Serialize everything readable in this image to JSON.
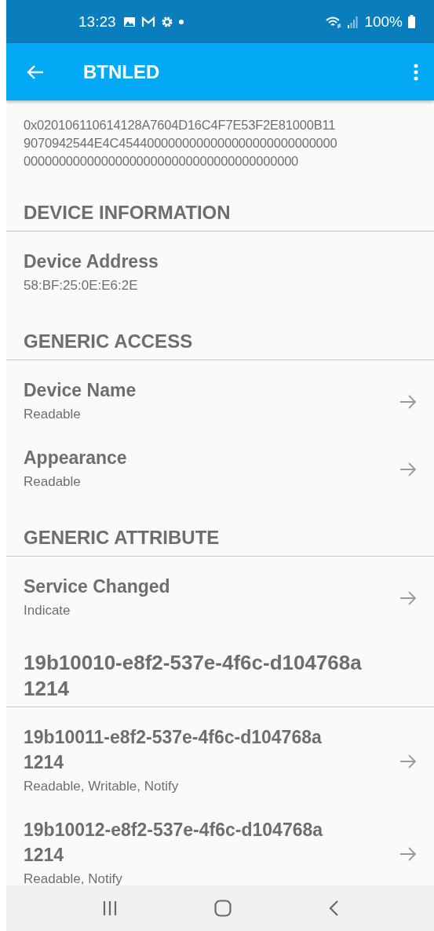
{
  "status_bar": {
    "time": "13:23",
    "battery": "100%"
  },
  "app_bar": {
    "title": "BTNLED"
  },
  "raw_packet": {
    "value": "0x020106110614128A7604D16C4F7E53F2E81000B11\n9070942544E4C4544000000000000000000000000000\n000000000000000000000000000000000000000"
  },
  "rows": [
    {
      "kind": "heading",
      "title": "DEVICE INFORMATION"
    },
    {
      "kind": "entry",
      "title": "Device Address",
      "detail": "58:BF:25:0E:E6:2E"
    },
    {
      "kind": "heading",
      "title": "GENERIC ACCESS"
    },
    {
      "kind": "entry",
      "title": "Device Name",
      "detail": "Readable",
      "navigable": true
    },
    {
      "kind": "entry",
      "title": "Appearance",
      "detail": "Readable",
      "navigable": true
    },
    {
      "kind": "heading",
      "title": "GENERIC ATTRIBUTE"
    },
    {
      "kind": "entry",
      "title": "Service Changed",
      "detail": "Indicate",
      "navigable": true
    },
    {
      "kind": "service",
      "title": "19b10010-e8f2-537e-4f6c-d104768a\n1214"
    },
    {
      "kind": "entry",
      "title": "19b10011-e8f2-537e-4f6c-d104768a\n1214",
      "detail": "Readable, Writable, Notify",
      "navigable": true
    },
    {
      "kind": "entry",
      "title": "19b10012-e8f2-537e-4f6c-d104768a\n1214",
      "detail": "Readable, Notify",
      "navigable": true
    }
  ]
}
